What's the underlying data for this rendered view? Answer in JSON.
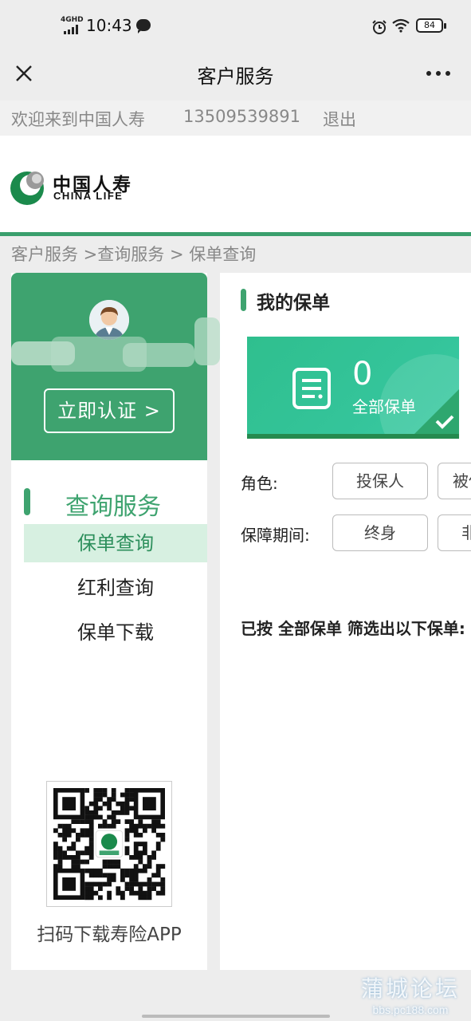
{
  "status_bar": {
    "network": "4GHD",
    "time": "10:43",
    "battery": "84"
  },
  "nav": {
    "title": "客户服务"
  },
  "welcome": {
    "text": "欢迎来到中国人寿",
    "phone": "13509539891",
    "logout": "退出"
  },
  "logo": {
    "cn": "中国人寿",
    "en": "CHINA LIFE"
  },
  "breadcrumb": "客户服务 >查询服务 > 保单查询",
  "sidebar": {
    "verify_button": "立即认证 >",
    "menu_title": "查询服务",
    "items": [
      {
        "label": "保单查询",
        "active": true
      },
      {
        "label": "红利查询",
        "active": false
      },
      {
        "label": "保单下载",
        "active": false
      }
    ],
    "qr_caption": "扫码下载寿险APP"
  },
  "main": {
    "title": "我的保单",
    "policy_card": {
      "count": "0",
      "label": "全部保单"
    },
    "filters": [
      {
        "label": "角色:",
        "options": [
          "投保人",
          "被保险人"
        ]
      },
      {
        "label": "保障期间:",
        "options": [
          "终身",
          "非终身"
        ]
      }
    ],
    "result_note": "已按 全部保单 筛选出以下保单:"
  },
  "watermark": {
    "cn": "蒲城论坛",
    "url": "bbs.pc188.com"
  },
  "colors": {
    "brand_green": "#3ea36f",
    "card_green": "#34c49a",
    "active_menu_bg": "#d7f0e1"
  }
}
